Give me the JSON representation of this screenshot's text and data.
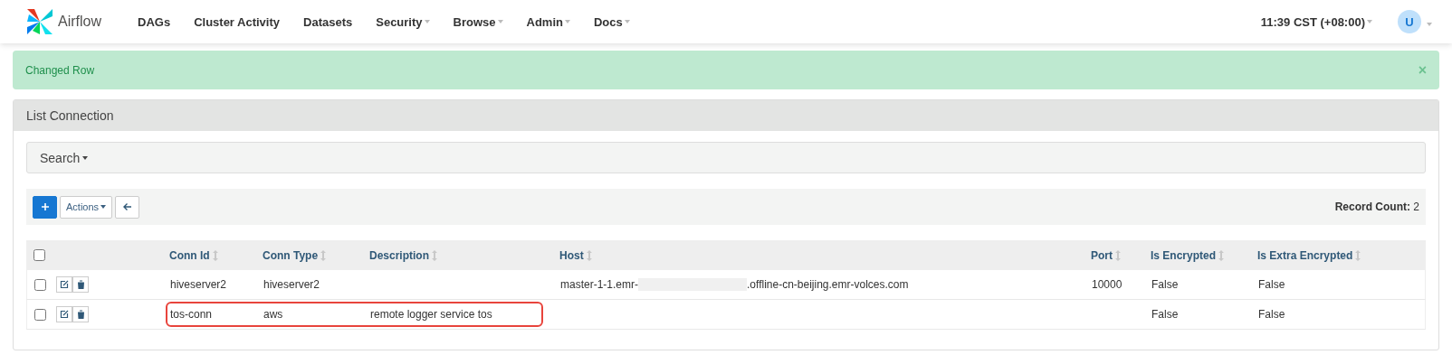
{
  "navbar": {
    "brand": "Airflow",
    "items": [
      {
        "label": "DAGs",
        "dropdown": false
      },
      {
        "label": "Cluster Activity",
        "dropdown": false
      },
      {
        "label": "Datasets",
        "dropdown": false
      },
      {
        "label": "Security",
        "dropdown": true
      },
      {
        "label": "Browse",
        "dropdown": true
      },
      {
        "label": "Admin",
        "dropdown": true
      },
      {
        "label": "Docs",
        "dropdown": true
      }
    ],
    "time": "11:39 CST (+08:00)",
    "user_initial": "U"
  },
  "alert": {
    "message": "Changed Row",
    "close": "×"
  },
  "panel": {
    "title": "List Connection",
    "search": "Search",
    "actions": "Actions",
    "record_count_label": "Record Count:",
    "record_count": "2"
  },
  "table": {
    "select_all_checked": false,
    "columns": [
      "Conn Id",
      "Conn Type",
      "Description",
      "Host",
      "Port",
      "Is Encrypted",
      "Is Extra Encrypted"
    ],
    "rows": [
      {
        "checked": false,
        "highlighted": false,
        "cells": [
          "hiveserver2",
          "hiveserver2",
          "",
          {
            "before": "master-1-1.emr-",
            "after": ".offline-cn-beijing.emr-volces.com"
          },
          "10000",
          "False",
          "False"
        ]
      },
      {
        "checked": false,
        "highlighted": true,
        "cells": [
          "tos-conn",
          "aws",
          "remote logger service tos",
          "",
          "",
          "False",
          "False"
        ]
      }
    ]
  }
}
